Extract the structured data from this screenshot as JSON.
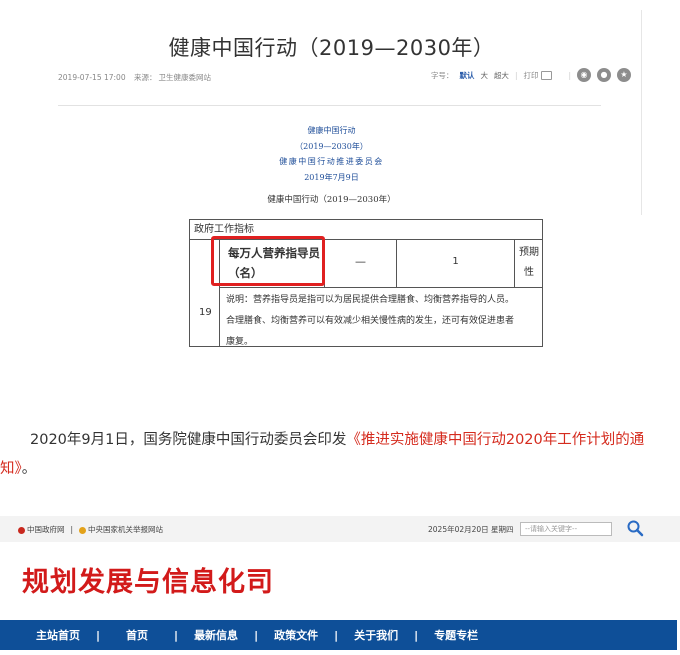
{
  "article": {
    "title": "健康中国行动（2019—2030年）",
    "meta": {
      "datetime": "2019-07-15 17:00",
      "source_label": "来源：",
      "source": "卫生健康委网站",
      "font_size_label": "字号：",
      "font_sizes": [
        "默认",
        "大",
        "超大"
      ],
      "print_label": "打印"
    },
    "doc_lines": [
      "健康中国行动",
      "（2019—2030年）",
      "健康中国行动推进委员会",
      "2019年7月9日"
    ],
    "doc_heading": "健康中国行动（2019—2030年）"
  },
  "indicator_table": {
    "section": "政府工作指标",
    "row_number": "19",
    "name_line1": "每万人营养指导员",
    "name_line2": "（名）",
    "value_2022": "—",
    "value_2030": "1",
    "kind_line1": "预期",
    "kind_line2": "性",
    "note_line1": "说明：营养指导员是指可以为居民提供合理膳食、均衡营养指导的人员。",
    "note_line2": "合理膳食、均衡营养可以有效减少相关慢性病的发生，还可有效促进患者",
    "note_line3": "康复。"
  },
  "paragraph": {
    "text_before": "2020年9月1日，国务院健康中国行动委员会印发",
    "link_text": "《推进实施健康中国行动2020年工作计划的通知》",
    "text_after": "。"
  },
  "site": {
    "topbar": {
      "link1": "中国政府网",
      "divider": "|",
      "link2": "中央国家机关举报网站",
      "date": "2025年02月20日 星期四",
      "search_placeholder": "--请输入关键字--"
    },
    "title": "规划发展与信息化司",
    "nav": [
      "主站首页",
      "首页",
      "最新信息",
      "政策文件",
      "关于我们",
      "专题专栏"
    ],
    "nav_separator": "|"
  },
  "colors": {
    "nav_background": "#0e4f98",
    "site_title": "#d21a1a",
    "link": "#d52b1e",
    "highlight_box": "#e02020",
    "doc_text": "#1f4e99"
  }
}
